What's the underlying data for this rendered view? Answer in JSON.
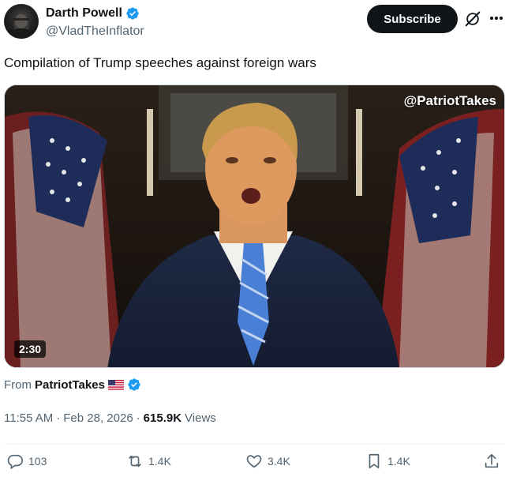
{
  "author": {
    "display_name": "Darth Powell",
    "handle": "@VladTheInflator",
    "verified": true
  },
  "header": {
    "subscribe_label": "Subscribe",
    "grok_icon": "grok-icon",
    "more_icon": "more-icon"
  },
  "tweet": {
    "text": "Compilation of Trump speeches against foreign wars"
  },
  "media": {
    "watermark": "@PatriotTakes",
    "duration": "2:30"
  },
  "source": {
    "from_label": "From",
    "name": "PatriotTakes",
    "flag_icon": "us-flag-icon",
    "verified": true
  },
  "meta": {
    "time": "11:55 AM",
    "separator1": "·",
    "date": "Feb 28, 2026",
    "separator2": "·",
    "views_count": "615.9K",
    "views_label": "Views"
  },
  "actions": {
    "replies": "103",
    "reposts": "1.4K",
    "likes": "3.4K",
    "bookmarks": "1.4K"
  },
  "colors": {
    "text_primary": "#0f1419",
    "text_secondary": "#536471",
    "verified_blue": "#1d9bf0",
    "button_bg": "#0f1419"
  }
}
